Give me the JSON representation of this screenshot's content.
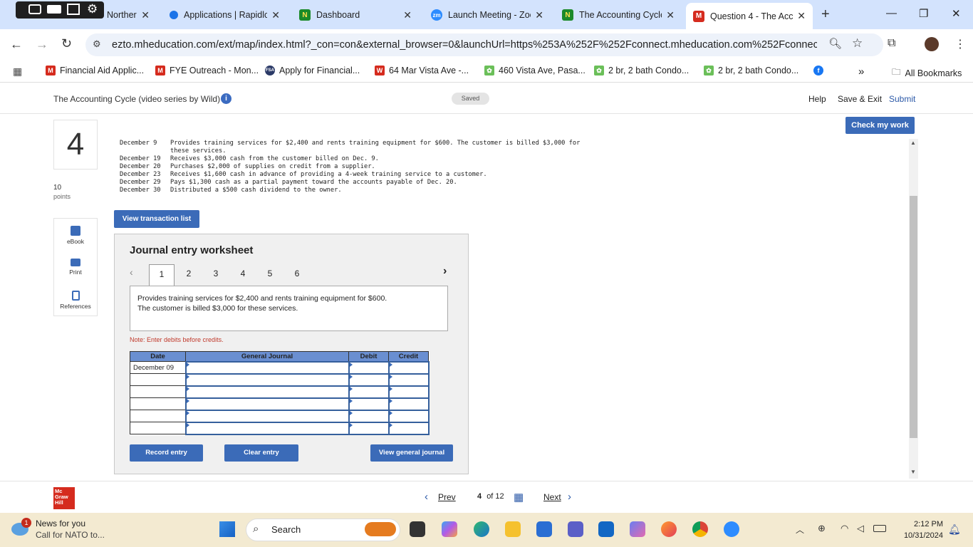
{
  "browser": {
    "tabs": [
      {
        "title": "Norther",
        "favicon": "northern-icon",
        "color": "#2e7d32"
      },
      {
        "title": "Applications | Rapidlc",
        "favicon": "rapid-icon",
        "color": "#1a73e8"
      },
      {
        "title": "Dashboard",
        "favicon": "N",
        "color": "#1b8a2a"
      },
      {
        "title": "Launch Meeting - Zoo",
        "favicon": "zm",
        "color": "#2d8cff"
      },
      {
        "title": "The Accounting Cycle",
        "favicon": "N",
        "color": "#1b8a2a"
      },
      {
        "title": "Question 4 - The Acc",
        "favicon": "M",
        "color": "#d52b1e"
      }
    ],
    "url": "ezto.mheducation.com/ext/map/index.html?_con=con&external_browser=0&launchUrl=https%253A%252F%252Fconnect.mheducation.com%252Fconnect%25...",
    "bookmarks": [
      {
        "label": "Financial Aid Applic...",
        "icon": "gmail-icon",
        "color": "#d52b1e",
        "glyph": "M"
      },
      {
        "label": "FYE Outreach - Mon...",
        "icon": "gmail-icon",
        "color": "#d52b1e",
        "glyph": "M"
      },
      {
        "label": "Apply for Financial...",
        "icon": "fsa-icon",
        "color": "#2b3a67",
        "glyph": "FSA"
      },
      {
        "label": "64 Mar Vista Ave -...",
        "icon": "w-icon",
        "color": "#d52b1e",
        "glyph": "W"
      },
      {
        "label": "460 Vista Ave, Pasa...",
        "icon": "green-icon",
        "color": "#6bbf59",
        "glyph": "✿"
      },
      {
        "label": "2 br, 2 bath Condo...",
        "icon": "green-icon",
        "color": "#6bbf59",
        "glyph": "✿"
      },
      {
        "label": "2 br, 2 bath Condo...",
        "icon": "green-icon",
        "color": "#6bbf59",
        "glyph": "✿"
      }
    ],
    "all_bookmarks": "All Bookmarks",
    "more": "»"
  },
  "header": {
    "assignment": "The Accounting Cycle (video series by Wild)",
    "saved": "Saved",
    "help": "Help",
    "save_exit": "Save & Exit",
    "submit": "Submit",
    "check": "Check my work"
  },
  "question": {
    "number": "4",
    "points_value": "10",
    "points_label": "points",
    "tools": [
      "eBook",
      "Print",
      "References"
    ]
  },
  "transactions": [
    {
      "date": "December 9",
      "text": "Provides training services for $2,400 and rents training equipment for $600. The customer is billed $3,000 for"
    },
    {
      "date": "",
      "text": "these services."
    },
    {
      "date": "December 19",
      "text": "Receives $3,000 cash from the customer billed on Dec. 9."
    },
    {
      "date": "December 20",
      "text": "Purchases $2,000 of supplies on credit from a supplier."
    },
    {
      "date": "December 23",
      "text": "Receives $1,600 cash in advance of providing a 4-week training service to a customer."
    },
    {
      "date": "December 29",
      "text": "Pays $1,300 cash as a partial payment toward the accounts payable of Dec. 20."
    },
    {
      "date": "December 30",
      "text": "Distributed a $500 cash dividend to the owner."
    }
  ],
  "view_transactions": "View transaction list",
  "worksheet": {
    "title": "Journal entry worksheet",
    "pages": [
      "1",
      "2",
      "3",
      "4",
      "5",
      "6"
    ],
    "active_page": "1",
    "description_line1": "Provides training services for $2,400 and rents training equipment for $600.",
    "description_line2": "The customer is billed $3,000 for these services.",
    "note": "Note: Enter debits before credits.",
    "columns": [
      "Date",
      "General Journal",
      "Debit",
      "Credit"
    ],
    "first_date": "December 09",
    "buttons": {
      "record": "Record entry",
      "clear": "Clear entry",
      "view": "View general journal"
    }
  },
  "footer": {
    "logo": "Mc Graw Hill",
    "prev": "Prev",
    "page_current": "4",
    "page_of": "of 12",
    "next": "Next"
  },
  "taskbar": {
    "news_title": "News for you",
    "news_sub": "Call for NATO to...",
    "news_badge": "1",
    "search": "Search",
    "time": "2:12 PM",
    "date": "10/31/2024"
  }
}
